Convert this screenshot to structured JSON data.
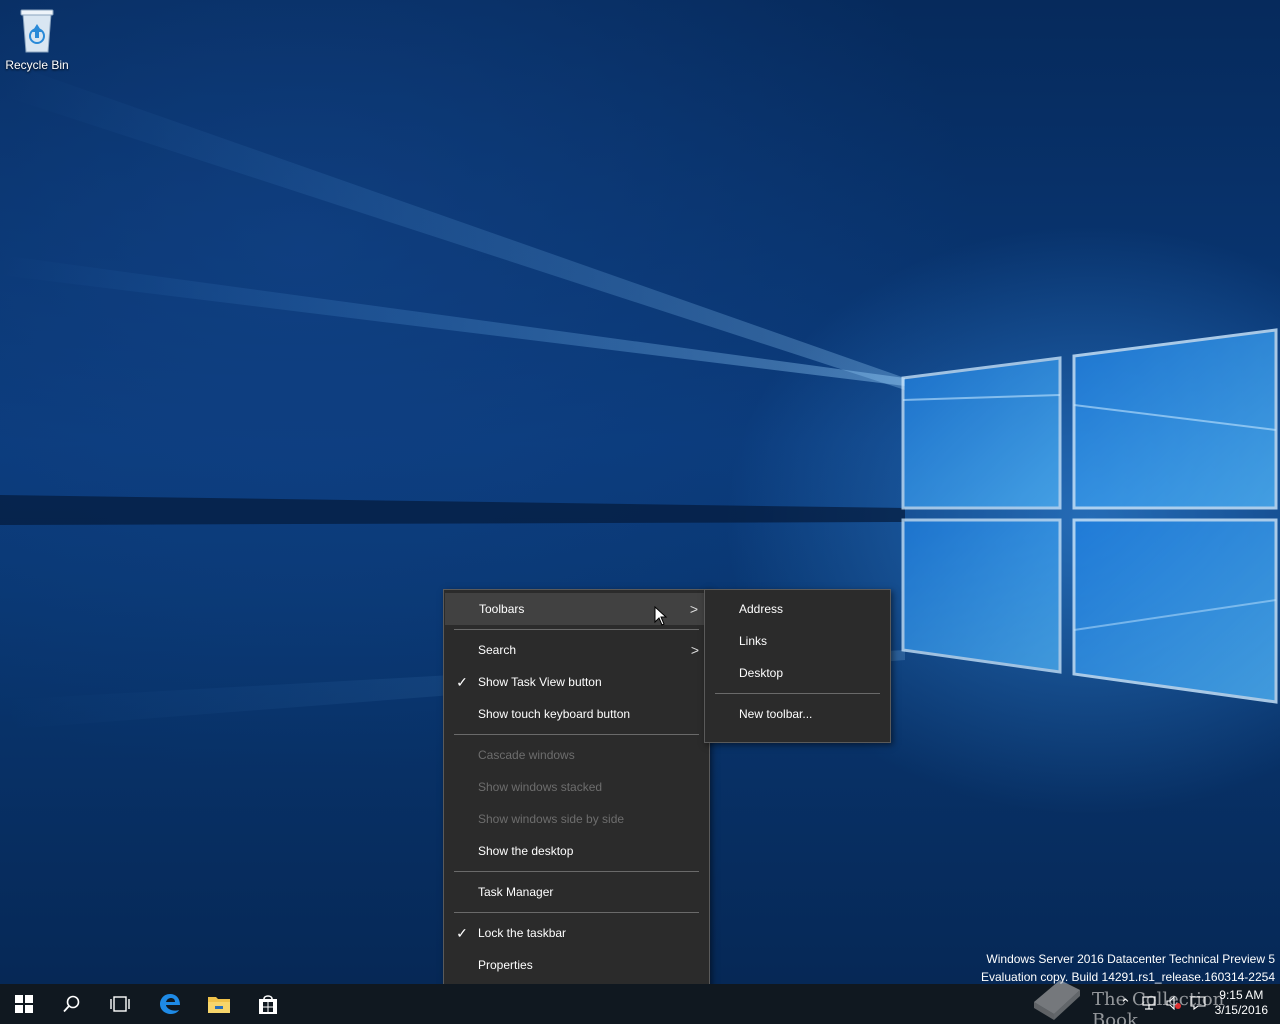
{
  "desktop": {
    "icons": [
      {
        "label": "Recycle Bin",
        "icon": "recycle-bin-icon"
      }
    ],
    "watermark": {
      "line1": "Windows Server 2016 Datacenter Technical Preview 5",
      "line2": "Evaluation copy. Build 14291.rs1_release.160314-2254"
    }
  },
  "context_menu": {
    "items": [
      {
        "label": "Toolbars",
        "submenu": true,
        "highlighted": true
      },
      {
        "label": "Search",
        "submenu": true
      },
      {
        "label": "Show Task View button",
        "checked": true
      },
      {
        "label": "Show touch keyboard button"
      },
      {
        "label": "Cascade windows",
        "disabled": true
      },
      {
        "label": "Show windows stacked",
        "disabled": true
      },
      {
        "label": "Show windows side by side",
        "disabled": true
      },
      {
        "label": "Show the desktop"
      },
      {
        "label": "Task Manager"
      },
      {
        "label": "Lock the taskbar",
        "checked": true
      },
      {
        "label": "Properties"
      }
    ],
    "check_glyph": "✓",
    "arrow_glyph": ">"
  },
  "toolbars_submenu": {
    "items": [
      {
        "label": "Address"
      },
      {
        "label": "Links"
      },
      {
        "label": "Desktop"
      },
      {
        "label": "New toolbar..."
      }
    ]
  },
  "taskbar": {
    "buttons": [
      {
        "name": "start-button",
        "icon": "windows-logo-icon"
      },
      {
        "name": "search-button",
        "icon": "search-icon"
      },
      {
        "name": "task-view-button",
        "icon": "task-view-icon"
      },
      {
        "name": "edge-button",
        "icon": "edge-icon"
      },
      {
        "name": "file-explorer-button",
        "icon": "folder-icon"
      },
      {
        "name": "store-button",
        "icon": "store-icon"
      }
    ],
    "clock": {
      "time": "9:15 AM",
      "date": "3/15/2016"
    },
    "brand_text": "The Collection Book"
  },
  "colors": {
    "menu_bg": "#2b2b2b",
    "menu_hover": "#414141",
    "menu_disabled_text": "#6d6d6d",
    "taskbar_bg": "#101820",
    "accent": "#0078d7"
  }
}
